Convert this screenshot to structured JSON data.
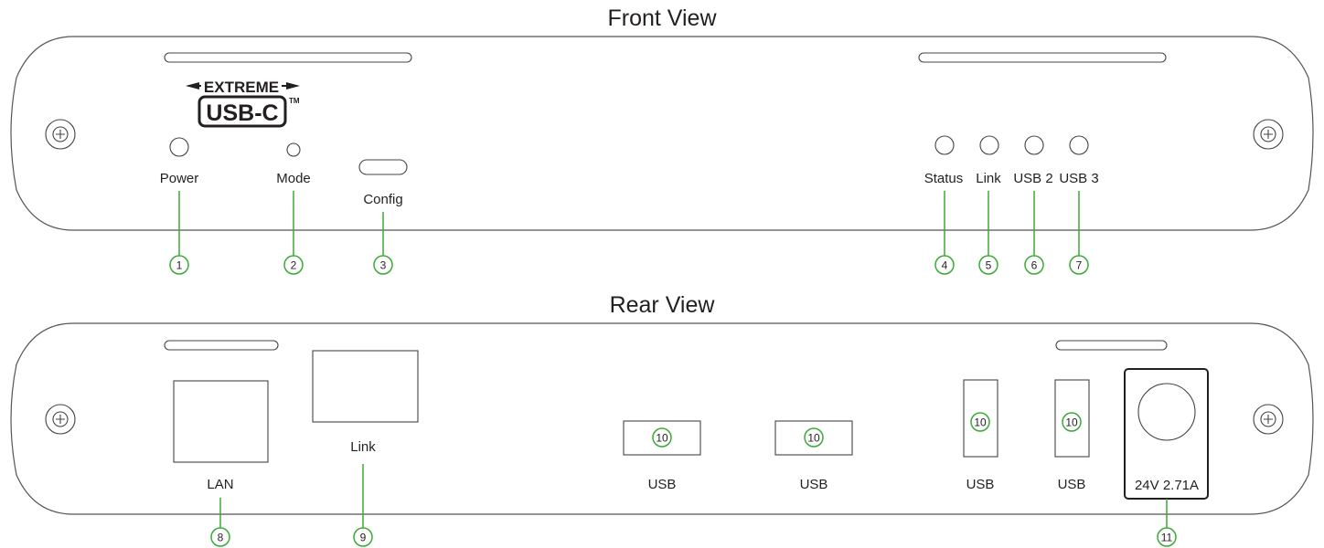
{
  "front": {
    "title": "Front View",
    "logo_top": "EXTREME",
    "logo_bottom": "USB-C",
    "logo_tm": "TM",
    "labels": {
      "power": "Power",
      "mode": "Mode",
      "config": "Config",
      "status": "Status",
      "link": "Link",
      "usb2": "USB 2",
      "usb3": "USB 3"
    },
    "callouts": [
      "1",
      "2",
      "3",
      "4",
      "5",
      "6",
      "7"
    ]
  },
  "rear": {
    "title": "Rear View",
    "labels": {
      "lan": "LAN",
      "link": "Link",
      "usb": "USB",
      "power_rating": "24V 2.71A"
    },
    "callouts": {
      "lan": "8",
      "link": "9",
      "usb": "10",
      "power": "11"
    }
  },
  "colors": {
    "outline": "#555555",
    "callout": "#3aaa35",
    "text": "#231f20"
  }
}
